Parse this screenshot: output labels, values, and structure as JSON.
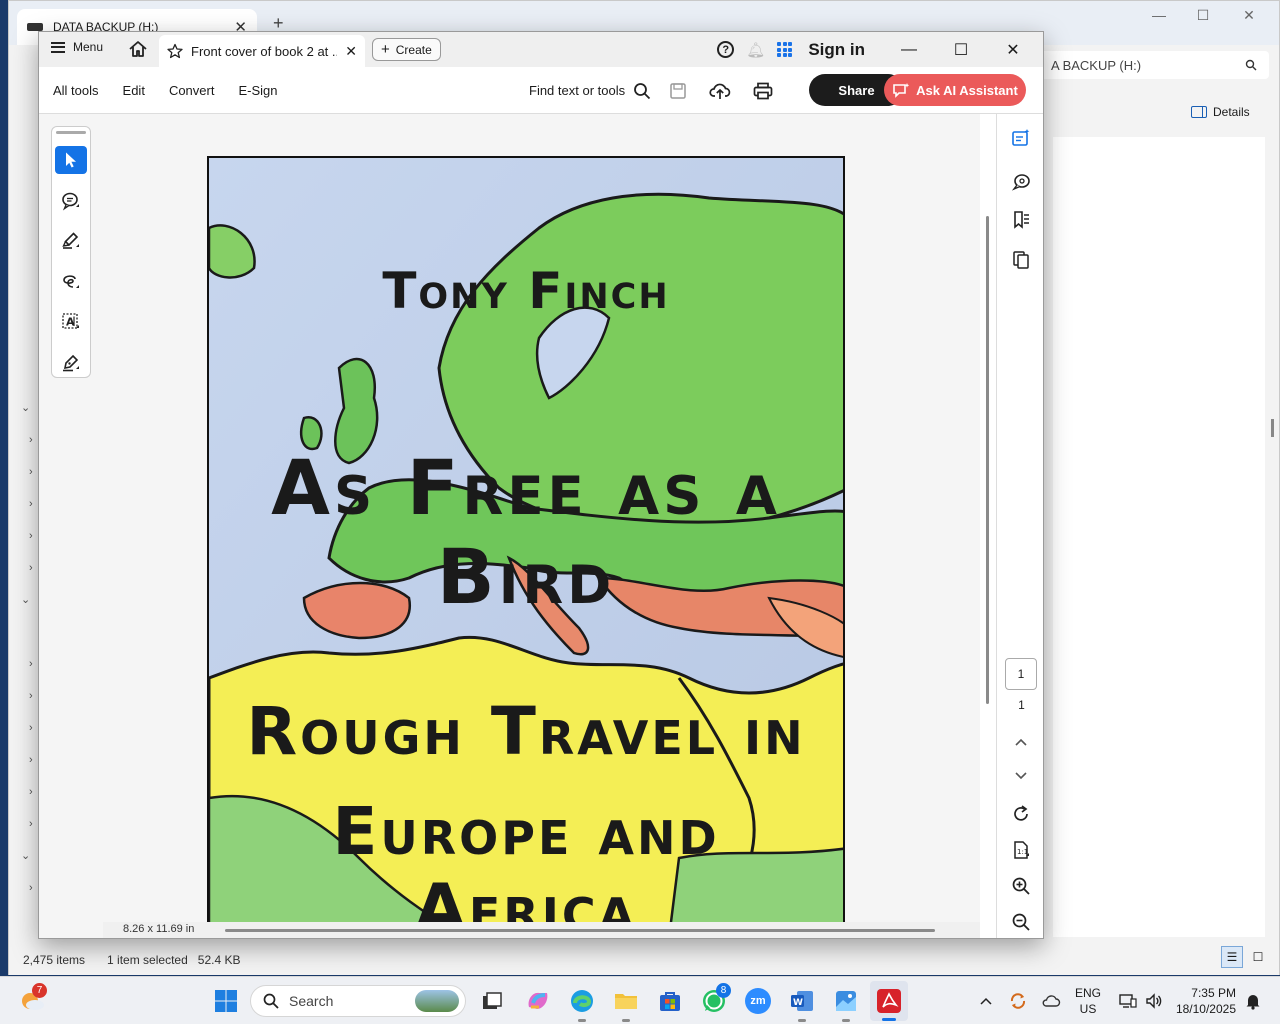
{
  "explorer": {
    "tab_title": "DATA BACKUP (H:)",
    "new_tab": "+",
    "min": "—",
    "max": "☐",
    "close": "✕",
    "address_partial": "A BACKUP (H:)",
    "details_label": "Details",
    "status_items": "2,475 items",
    "status_selected": "1 item selected",
    "status_size": "52.4 KB"
  },
  "acrobat": {
    "menu_label": "Menu",
    "doc_tab_title": "Front cover of book 2 at ...",
    "create_label": "Create",
    "sign_in": "Sign in",
    "toolbar": {
      "all_tools": "All tools",
      "edit": "Edit",
      "convert": "Convert",
      "esign": "E-Sign",
      "find": "Find text or tools",
      "share": "Share",
      "ai_assistant": "Ask AI Assistant"
    },
    "page_size": "8.26 x 11.69 in",
    "page_current": "1",
    "page_total": "1",
    "cover": {
      "author": "Tony Finch",
      "title": "As Free as a Bird",
      "subtitle_line1": "Rough Travel in",
      "subtitle_line2": "Europe and Africa"
    }
  },
  "taskbar": {
    "weather_badge": "7",
    "search_placeholder": "Search",
    "whatsapp_badge": "8",
    "zoom_label": "zm",
    "lang_line1": "ENG",
    "lang_line2": "US",
    "time": "7:35 PM",
    "date": "18/10/2025"
  },
  "colors": {
    "accent_blue": "#1473e6",
    "ai_button": "#eb5a5a",
    "share_button": "#1c1c1c"
  }
}
